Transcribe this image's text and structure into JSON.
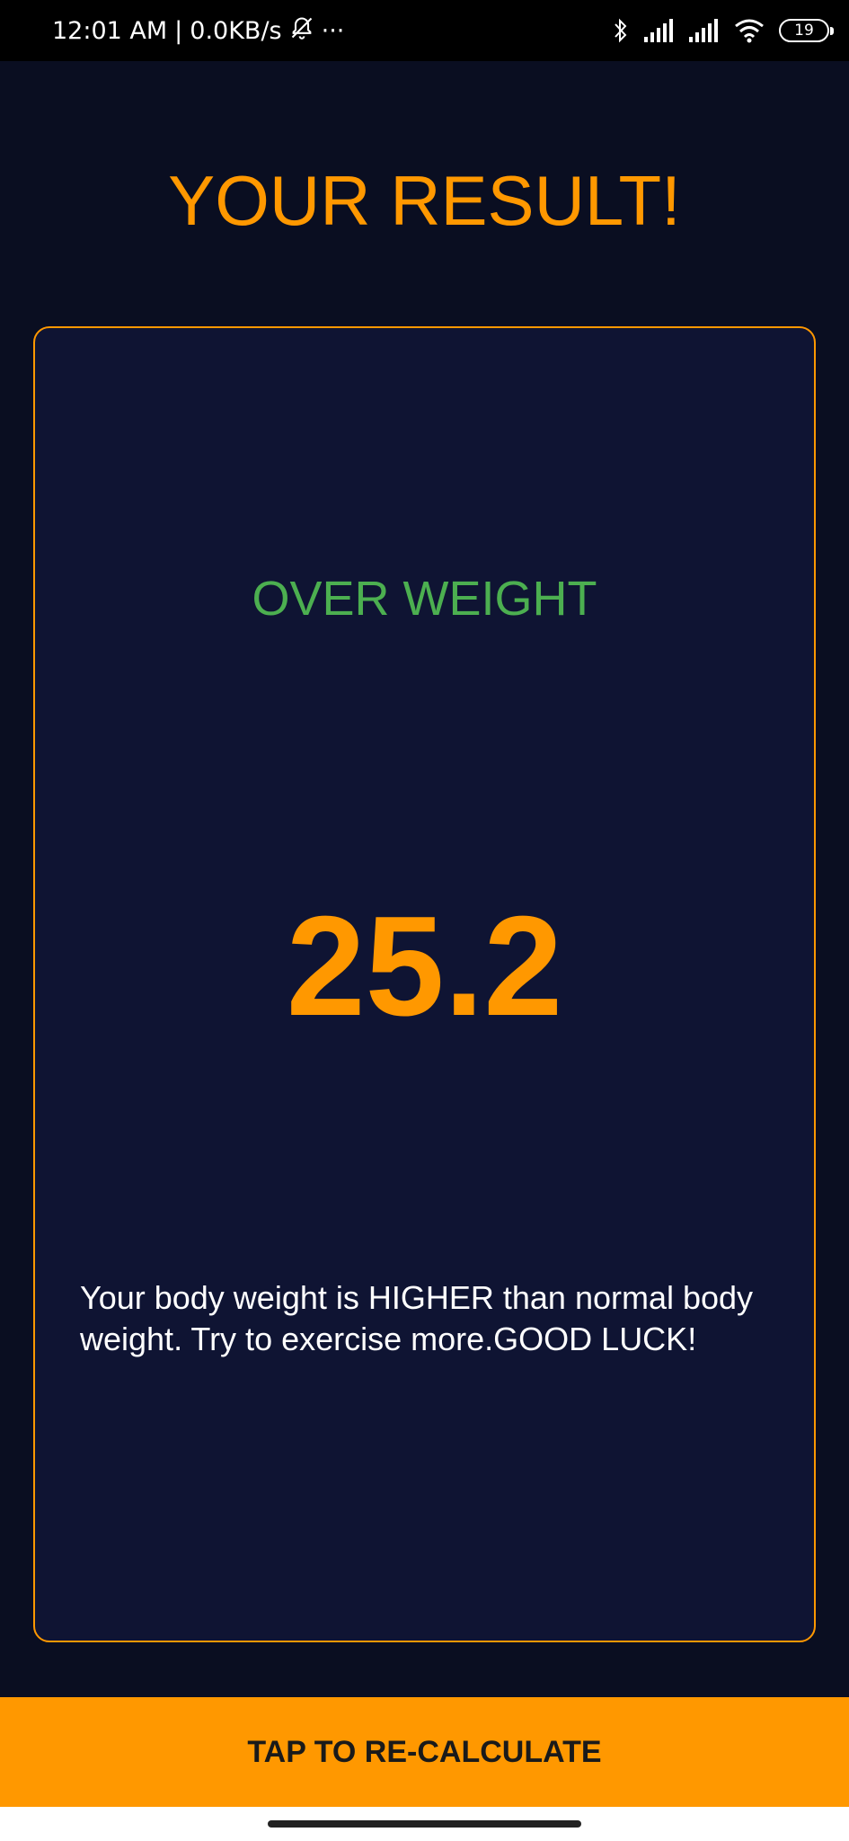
{
  "status_bar": {
    "time": "12:01 AM",
    "separator": "|",
    "network_speed": "0.0KB/s",
    "more": "···",
    "battery_level": "19",
    "icons": [
      "bell-off-icon",
      "bluetooth-icon",
      "signal-icon",
      "signal-icon",
      "wifi-icon",
      "battery-icon"
    ]
  },
  "header": {
    "title": "YOUR RESULT!"
  },
  "result": {
    "category": "OVER WEIGHT",
    "bmi_value": "25.2",
    "interpretation": "Your body weight is HIGHER than normal body weight. Try to exercise more.GOOD LUCK!"
  },
  "footer": {
    "button_label": "TAP TO RE-CALCULATE"
  },
  "colors": {
    "background": "#0a0e21",
    "card": "#0f1433",
    "accent": "#ff9800",
    "category_text": "#4caf50",
    "text": "#ffffff"
  }
}
